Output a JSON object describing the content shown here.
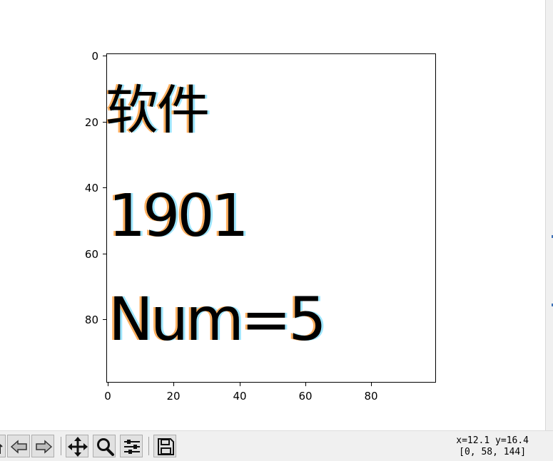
{
  "figure": {
    "image_lines": [
      "软件",
      "1901",
      "Num=5"
    ],
    "y_ticks": [
      "0",
      "20",
      "40",
      "60",
      "80"
    ],
    "x_ticks": [
      "0",
      "20",
      "40",
      "60",
      "80"
    ]
  },
  "toolbar": {
    "buttons": [
      {
        "name": "home",
        "icon": "home-icon"
      },
      {
        "name": "back",
        "icon": "arrow-left-icon"
      },
      {
        "name": "forward",
        "icon": "arrow-right-icon"
      },
      {
        "name": "pan",
        "icon": "move-icon"
      },
      {
        "name": "zoom",
        "icon": "magnifier-icon"
      },
      {
        "name": "configure-subplots",
        "icon": "sliders-icon"
      },
      {
        "name": "save",
        "icon": "floppy-disk-icon"
      }
    ],
    "status_line1": "x=12.1 y=16.4",
    "status_line2": "[0, 58, 144]"
  }
}
